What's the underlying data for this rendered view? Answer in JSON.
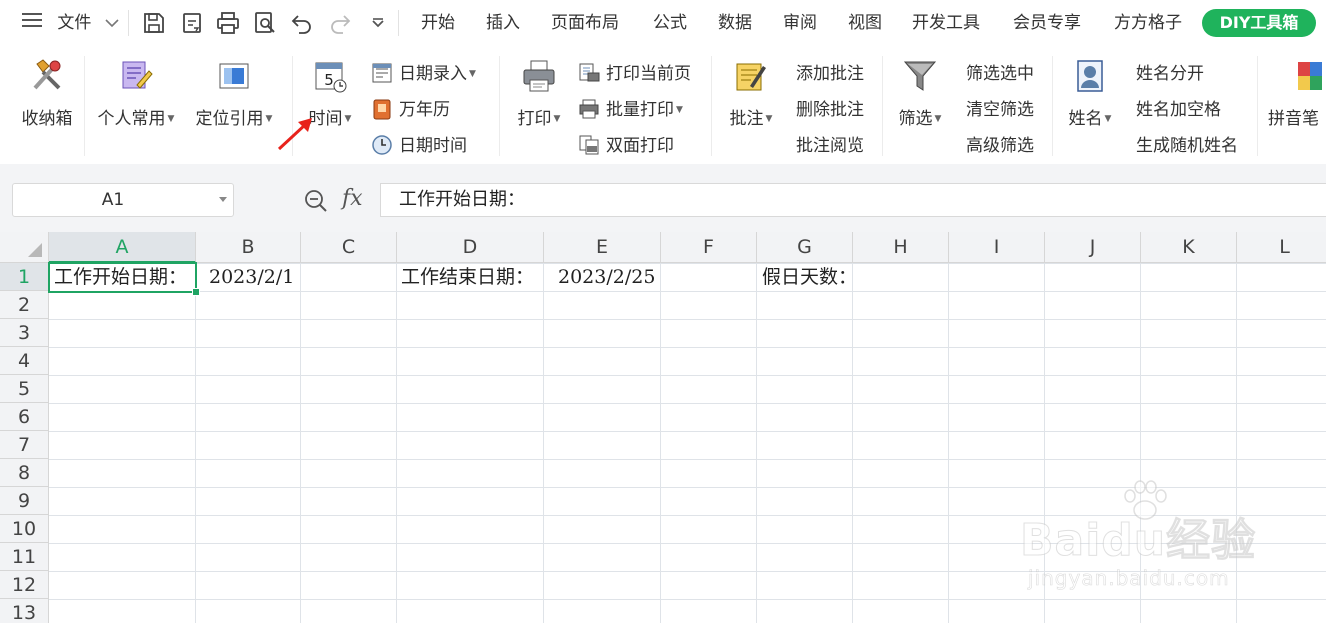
{
  "menubar": {
    "file_label": "文件",
    "tabs": [
      "开始",
      "插入",
      "页面布局",
      "公式",
      "数据",
      "审阅",
      "视图",
      "开发工具",
      "会员专享",
      "方方格子"
    ],
    "diy_tab": "DIY工具箱"
  },
  "ribbon": {
    "storage": "收纳箱",
    "personal": "个人常用",
    "locate_ref": "定位引用",
    "time": "时间",
    "date_entry": "日期录入",
    "calendar": "万年历",
    "date_time": "日期时间",
    "print": "打印",
    "print_current": "打印当前页",
    "batch_print": "批量打印",
    "duplex_print": "双面打印",
    "comment": "批注",
    "add_comment": "添加批注",
    "delete_comment": "删除批注",
    "view_comment": "批注阅览",
    "filter": "筛选",
    "filter_selected": "筛选选中",
    "clear_filter": "清空筛选",
    "advanced_filter": "高级筛选",
    "name": "姓名",
    "name_split": "姓名分开",
    "name_add_space": "姓名加空格",
    "random_name": "生成随机姓名",
    "pinyin": "拼音笔"
  },
  "formula_bar": {
    "name_box": "A1",
    "fx_label": "fx",
    "formula": "工作开始日期："
  },
  "sheet": {
    "columns": [
      "A",
      "B",
      "C",
      "D",
      "E",
      "F",
      "G",
      "H",
      "I",
      "J",
      "K",
      "L"
    ],
    "rows": [
      "1",
      "2",
      "3",
      "4",
      "5",
      "6",
      "7",
      "8",
      "9",
      "10",
      "11",
      "12",
      "13"
    ],
    "cells": {
      "A1": "工作开始日期：",
      "B1": "2023/2/1",
      "D1": "工作结束日期：",
      "E1": "2023/2/25",
      "G1": "假日天数："
    },
    "active_cell": "A1"
  },
  "watermark": {
    "main": "Baidu经验",
    "sub": "jingyan.baidu.com"
  },
  "colors": {
    "accent": "#1fa463",
    "diy_badge": "#1fb35c",
    "annotation_arrow": "#e8221b"
  }
}
